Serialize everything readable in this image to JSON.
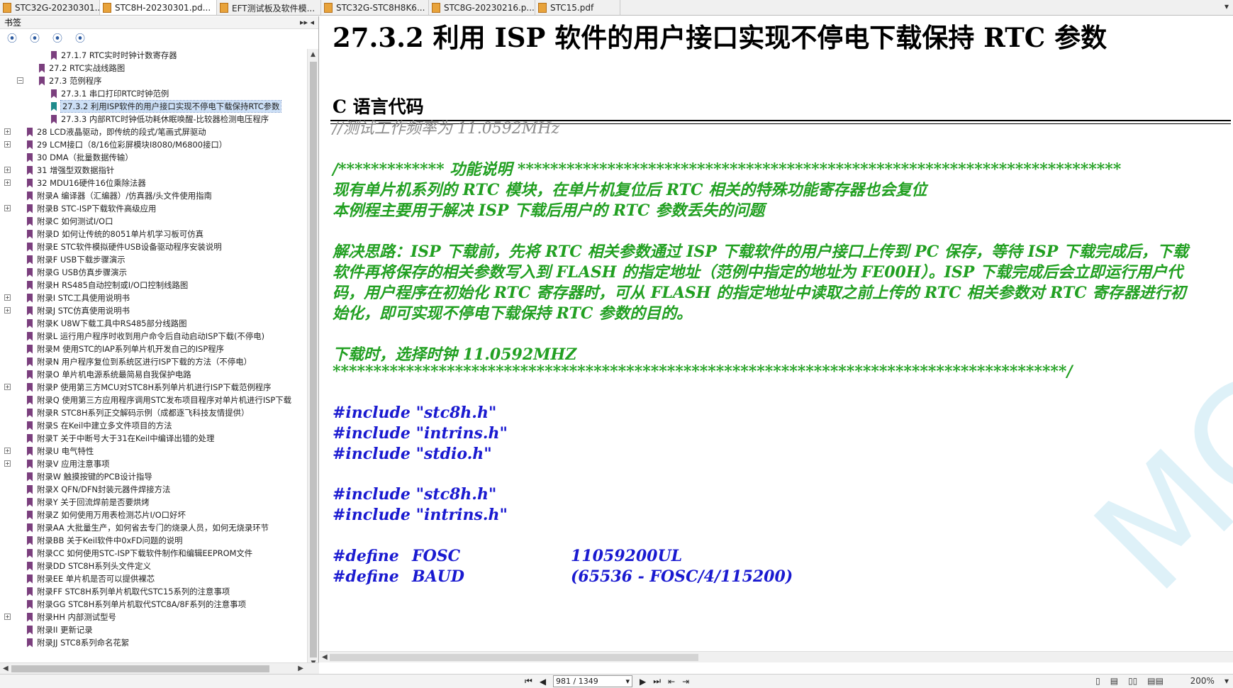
{
  "tabs": [
    {
      "label": "STC32G-20230301...",
      "active": false
    },
    {
      "label": "STC8H-20230301.pd...",
      "active": true
    },
    {
      "label": "EFT测试板及软件模...",
      "active": false
    },
    {
      "label": "STC32G-STC8H8K6...",
      "active": false
    },
    {
      "label": "STC8G-20230216.p...",
      "active": false
    },
    {
      "label": "STC15.pdf",
      "active": false
    }
  ],
  "sidebar": {
    "title": "书签",
    "controls": "▸▸ ◂",
    "tools": [
      "⦿",
      "⦿",
      "⦿",
      "⦿"
    ],
    "items": [
      {
        "label": "27.1.7 RTC实时时钟计数寄存器"
      },
      {
        "label": "27.2 RTC实战线路图"
      },
      {
        "label": "27.3 范例程序"
      },
      {
        "label": "27.3.1 串口打印RTC时钟范例"
      },
      {
        "label": "27.3.2 利用ISP软件的用户接口实现不停电下载保持RTC参数"
      },
      {
        "label": "27.3.3 内部RTC时钟低功耗休眠唤醒-比较器检测电压程序"
      },
      {
        "label": "28 LCD液晶驱动，即传统的段式/笔画式屏驱动"
      },
      {
        "label": "29 LCM接口（8/16位彩屏模块I8080/M6800接口）"
      },
      {
        "label": "30 DMA（批量数据传输）"
      },
      {
        "label": "31 增强型双数据指针"
      },
      {
        "label": "32 MDU16硬件16位乘除法器"
      },
      {
        "label": "附录A 编译器（汇编器）/仿真器/头文件使用指南"
      },
      {
        "label": "附录B STC-ISP下载软件高级应用"
      },
      {
        "label": "附录C 如何测试I/O口"
      },
      {
        "label": "附录D 如何让传统的8051单片机学习板可仿真"
      },
      {
        "label": "附录E STC软件模拟硬件USB设备驱动程序安装说明"
      },
      {
        "label": "附录F USB下载步骤演示"
      },
      {
        "label": "附录G USB仿真步骤演示"
      },
      {
        "label": "附录H RS485自动控制或I/O口控制线路图"
      },
      {
        "label": "附录I STC工具使用说明书"
      },
      {
        "label": "附录J STC仿真使用说明书"
      },
      {
        "label": "附录K U8W下载工具中RS485部分线路图"
      },
      {
        "label": "附录L 运行用户程序时收到用户命令后自动启动ISP下载(不停电)"
      },
      {
        "label": "附录M 使用STC的IAP系列单片机开发自己的ISP程序"
      },
      {
        "label": "附录N 用户程序复位到系统区进行ISP下载的方法（不停电）"
      },
      {
        "label": "附录O 单片机电源系统最简易自我保护电路"
      },
      {
        "label": "附录P 使用第三方MCU对STC8H系列单片机进行ISP下载范例程序"
      },
      {
        "label": "附录Q 使用第三方应用程序调用STC发布项目程序对单片机进行ISP下载"
      },
      {
        "label": "附录R STC8H系列正交解码示例（成都逐飞科技友情提供）"
      },
      {
        "label": "附录S 在Keil中建立多文件项目的方法"
      },
      {
        "label": "附录T 关于中断号大于31在Keil中编译出错的处理"
      },
      {
        "label": "附录U 电气特性"
      },
      {
        "label": "附录V 应用注意事项"
      },
      {
        "label": "附录W 触摸按键的PCB设计指导"
      },
      {
        "label": "附录X QFN/DFN封装元器件焊接方法"
      },
      {
        "label": "附录Y 关于回流焊前是否要烘烤"
      },
      {
        "label": "附录Z 如何使用万用表检测芯片I/O口好坏"
      },
      {
        "label": "附录AA 大批量生产，如何省去专门的烧录人员，如何无烧录环节"
      },
      {
        "label": "附录BB 关于Keil软件中0xFD问题的说明"
      },
      {
        "label": "附录CC 如何使用STC-ISP下载软件制作和编辑EEPROM文件"
      },
      {
        "label": "附录DD STC8H系列头文件定义"
      },
      {
        "label": "附录EE 单片机是否可以提供裸芯"
      },
      {
        "label": "附录FF STC8H系列单片机取代STC15系列的注意事项"
      },
      {
        "label": "附录GG STC8H系列单片机取代STC8A/8F系列的注意事项"
      },
      {
        "label": "附录HH 内部测试型号"
      },
      {
        "label": "附录II 更新记录"
      },
      {
        "label": "附录JJ STC8系列命名花絮"
      }
    ]
  },
  "document": {
    "heading": "27.3.2  利用 ISP 软件的用户接口实现不停电下载保持 RTC 参数",
    "subheading": "C 语言代码",
    "freq_comment": "//测试工作频率为 11.0592MHz",
    "func_header": "/*************    功能说明    **************************************************************************",
    "desc1": "现有单片机系列的 RTC 模块，在单片机复位后 RTC 相关的特殊功能寄存器也会复位",
    "desc2": "本例程主要用于解决 ISP 下载后用户的 RTC 参数丢失的问题",
    "sol1": "解决思路：ISP 下载前，先将 RTC 相关参数通过 ISP 下载软件的用户接口上传到 PC 保存，等待 ISP 下载完成后，下载",
    "sol2": "软件再将保存的相关参数写入到 FLASH 的指定地址（范例中指定的地址为 FE00H）。ISP 下载完成后会立即运行用户代",
    "sol3": "码，用户程序在初始化 RTC 寄存器时，可从 FLASH 的指定地址中读取之前上传的 RTC 相关参数对 RTC 寄存器进行初",
    "sol4": "始化，即可实现不停电下载保持 RTC 参数的目的。",
    "clock": "下载时，选择时钟 11.0592MHZ",
    "stars_end": "******************************************************************************************/",
    "inc1": "#include \"stc8h.h\"",
    "inc2": "#include \"intrins.h\"",
    "inc3": "#include \"stdio.h\"",
    "inc4": "#include \"stc8h.h\"",
    "inc5": "#include \"intrins.h\"",
    "def1_kw": "#define",
    "def1_name": "FOSC",
    "def1_val": "11059200UL",
    "def2_kw": "#define",
    "def2_name": "BAUD",
    "def2_val": "(65536 - FOSC/4/115200)",
    "watermark": "MCU"
  },
  "status": {
    "page": "981 / 1349",
    "zoom": "200%"
  },
  "colors": {
    "comment_gray": "#8c8c8c",
    "code_green": "#22a022",
    "code_blue": "#1a1ad0",
    "bookmark_purple": "#7b3f7e",
    "selection": "#cde0f7"
  }
}
